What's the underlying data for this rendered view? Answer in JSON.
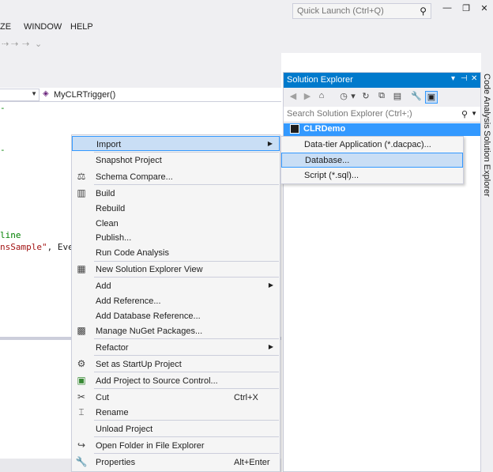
{
  "quick_launch": {
    "placeholder": "Quick Launch (Ctrl+Q)"
  },
  "menu": {
    "items": [
      "ZE",
      "WINDOW",
      "HELP"
    ]
  },
  "editor": {
    "member_dropdown": "MyCLRTrigger()",
    "code_lines": [
      {
        "text": "-",
        "style": "green"
      },
      {
        "text": "-",
        "style": "green"
      },
      {
        "text": "line",
        "style": "green"
      },
      {
        "text_red": "nsSample\"",
        "text_rest": ", Even"
      }
    ]
  },
  "solution_explorer": {
    "title": "Solution Explorer",
    "search_placeholder": "Search Solution Explorer (Ctrl+;)",
    "selected_item": "CLRDemo"
  },
  "side_tabs": [
    "Code Analysis",
    "Solution Explorer"
  ],
  "context_menu": {
    "items": [
      {
        "label": "Import",
        "icon": "",
        "shortcut": "",
        "submenu": true
      },
      {
        "label": "Snapshot Project",
        "icon": "",
        "shortcut": ""
      },
      {
        "label": "Schema Compare...",
        "icon": "schema-compare-icon",
        "shortcut": ""
      },
      {
        "label": "Build",
        "icon": "build-icon",
        "shortcut": ""
      },
      {
        "label": "Rebuild",
        "icon": "",
        "shortcut": ""
      },
      {
        "label": "Clean",
        "icon": "",
        "shortcut": ""
      },
      {
        "label": "Publish...",
        "icon": "",
        "shortcut": ""
      },
      {
        "label": "Run Code Analysis",
        "icon": "",
        "shortcut": ""
      },
      {
        "label": "New Solution Explorer View",
        "icon": "new-view-icon",
        "shortcut": ""
      },
      {
        "label": "Add",
        "icon": "",
        "shortcut": "",
        "submenu": true
      },
      {
        "label": "Add Reference...",
        "icon": "",
        "shortcut": ""
      },
      {
        "label": "Add Database Reference...",
        "icon": "",
        "shortcut": ""
      },
      {
        "label": "Manage NuGet Packages...",
        "icon": "nuget-icon",
        "shortcut": ""
      },
      {
        "label": "Refactor",
        "icon": "",
        "shortcut": "",
        "submenu": true
      },
      {
        "label": "Set as StartUp Project",
        "icon": "gear-icon",
        "shortcut": ""
      },
      {
        "label": "Add Project to Source Control...",
        "icon": "source-control-icon",
        "shortcut": ""
      },
      {
        "label": "Cut",
        "icon": "scissors-icon",
        "shortcut": "Ctrl+X"
      },
      {
        "label": "Rename",
        "icon": "rename-icon",
        "shortcut": ""
      },
      {
        "label": "Unload Project",
        "icon": "",
        "shortcut": ""
      },
      {
        "label": "Open Folder in File Explorer",
        "icon": "refresh-arrow-icon",
        "shortcut": ""
      },
      {
        "label": "Properties",
        "icon": "wrench-icon",
        "shortcut": "Alt+Enter"
      }
    ]
  },
  "import_submenu": {
    "items": [
      "Data-tier Application (*.dacpac)...",
      "Database...",
      "Script (*.sql)..."
    ]
  }
}
